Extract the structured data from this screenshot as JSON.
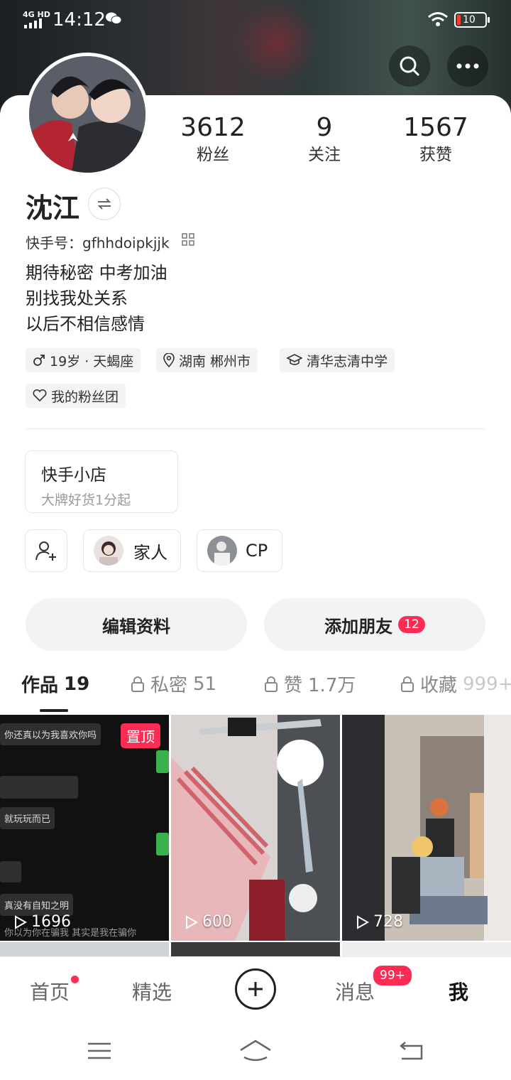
{
  "status": {
    "network": "4G HD",
    "time": "14:12",
    "battery": "10"
  },
  "profile": {
    "stats": [
      {
        "num": "3612",
        "label": "粉丝"
      },
      {
        "num": "9",
        "label": "关注"
      },
      {
        "num": "1567",
        "label": "获赞"
      }
    ],
    "name": "沈江",
    "kuaishou_id_label": "快手号：",
    "kuaishou_id": "gfhhdoipkjjk",
    "bio": [
      "期待秘密  中考加油",
      "别找我处关系",
      "以后不相信感情"
    ],
    "tags": [
      {
        "icon": "male-icon",
        "text": "19岁 · 天蝎座"
      },
      {
        "icon": "location-icon",
        "text": "湖南 郴州市"
      },
      {
        "icon": "school-icon",
        "text": "清华志清中学"
      },
      {
        "icon": "heart-icon",
        "text": "我的粉丝团"
      }
    ]
  },
  "shop": {
    "title": "快手小店",
    "subtitle": "大牌好货1分起"
  },
  "chips": [
    {
      "label": "家人"
    },
    {
      "label": "CP"
    }
  ],
  "actions": {
    "edit": "编辑资料",
    "add_friend": "添加朋友",
    "add_friend_badge": "12"
  },
  "tabs": [
    {
      "label": "作品",
      "count": "19"
    },
    {
      "label": "私密",
      "count": "51"
    },
    {
      "label": "赞",
      "count": "1.7万"
    },
    {
      "label": "收藏",
      "count": "999+"
    }
  ],
  "videos": [
    {
      "count": "1696",
      "pin": "置顶",
      "chat": [
        "你还真以为我喜欢你吗",
        "就玩玩而已",
        "真没有自知之明",
        "你以为你在骗我 其实是我在骗你"
      ]
    },
    {
      "count": "600"
    },
    {
      "count": "728"
    }
  ],
  "nav": {
    "home": "首页",
    "featured": "精选",
    "messages": "消息",
    "messages_badge": "99+",
    "me": "我"
  },
  "colors": {
    "accent": "#fe2c55"
  }
}
